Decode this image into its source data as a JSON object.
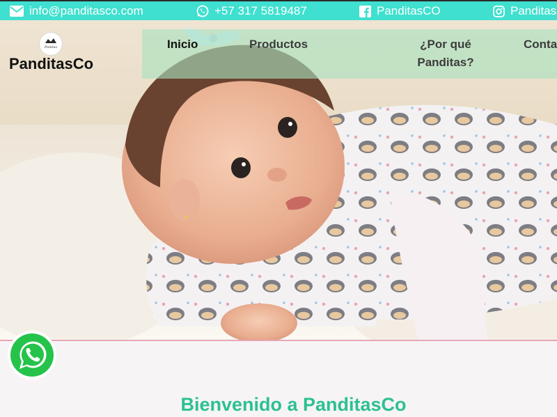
{
  "topbar": {
    "email": "info@panditasco.com",
    "phone": "+57 317 5819487",
    "facebook": "PanditasCO",
    "instagram": "Panditas",
    "icons": {
      "email": "envelope-icon",
      "phone": "whatsapp-icon",
      "facebook": "facebook-icon",
      "instagram": "instagram-icon"
    }
  },
  "brand": {
    "name": "PanditasCo",
    "logo_icon": "panda-logo-icon"
  },
  "nav": {
    "items": [
      {
        "label": "Inicio",
        "active": true
      },
      {
        "label": "Productos",
        "active": false
      },
      {
        "label": "¿Por qué",
        "label2": "Panditas?",
        "active": false
      },
      {
        "label": "Conta",
        "active": false
      }
    ]
  },
  "hero": {
    "image": "baby-in-hedgehog-pajamas-photo"
  },
  "main": {
    "welcome_title": "Bienvenido a PanditasCo"
  },
  "whatsapp_button": {
    "icon": "whatsapp-float-icon"
  },
  "colors": {
    "topbar": "#3fe0cf",
    "accent_green": "#2cc093",
    "nav_panel": "#a8e2be",
    "background": "#f7f4f5"
  }
}
